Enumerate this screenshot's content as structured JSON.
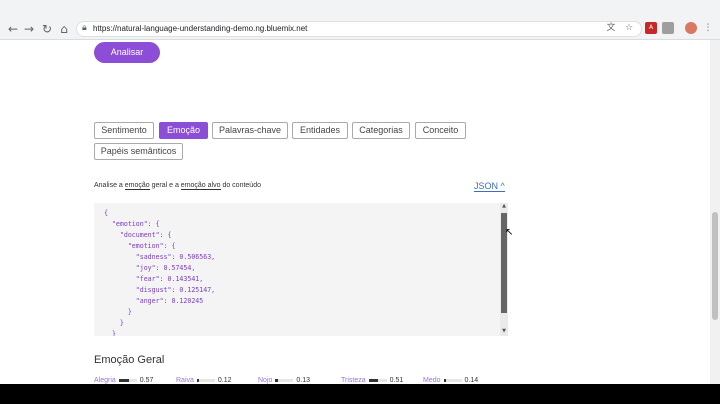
{
  "browser": {
    "url": "https://natural-language-understanding-demo.ng.bluemix.net",
    "icons": [
      "back-icon",
      "forward-icon",
      "reload-icon",
      "home-icon",
      "lock-icon",
      "translate-icon",
      "star-icon",
      "pdf-extension-icon",
      "extension-icon",
      "profile-avatar-icon"
    ]
  },
  "page": {
    "analyze_button": "Analisar",
    "tabs": [
      {
        "label": "Sentimento",
        "active": false
      },
      {
        "label": "Emoção",
        "active": true
      },
      {
        "label": "Palavras-chave",
        "active": false
      },
      {
        "label": "Entidades",
        "active": false
      },
      {
        "label": "Categorias",
        "active": false
      },
      {
        "label": "Conceito",
        "active": false
      },
      {
        "label": "Papéis semânticos",
        "active": false
      }
    ],
    "description": {
      "part1": "Analise a ",
      "link1": "emoção",
      "part2": " geral e a ",
      "link2": "emoção alvo",
      "part3": " do conteúdo"
    },
    "json_toggle": "JSON ^",
    "json_lines": [
      "{",
      "  \"emotion\": {",
      "    \"document\": {",
      "      \"emotion\": {",
      "        \"sadness\": 0.506563,",
      "        \"joy\": 0.57454,",
      "        \"fear\": 0.143541,",
      "        \"disgust\": 0.125147,",
      "        \"anger\": 0.120245",
      "      }",
      "    }",
      "  }"
    ],
    "section_title": "Emoção Geral",
    "emotion_bars": [
      {
        "label": "Alegria",
        "value": "0.57",
        "fraction": 0.57
      },
      {
        "label": "Raiva",
        "value": "0.12",
        "fraction": 0.12
      },
      {
        "label": "Nojo",
        "value": "0.13",
        "fraction": 0.13
      },
      {
        "label": "Tristeza",
        "value": "0.51",
        "fraction": 0.51
      },
      {
        "label": "Medo",
        "value": "0.14",
        "fraction": 0.14
      }
    ]
  },
  "colors": {
    "accent": "#8c4ed6",
    "link": "#3b6fb6"
  }
}
